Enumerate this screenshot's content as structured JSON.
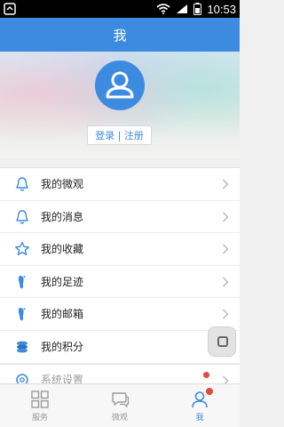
{
  "status_bar": {
    "time": "10:53"
  },
  "header": {
    "title": "我"
  },
  "profile": {
    "login_label": "登录 | 注册"
  },
  "menu": {
    "items": [
      {
        "label": "我的微观",
        "icon": "bell-icon"
      },
      {
        "label": "我的消息",
        "icon": "bell-icon"
      },
      {
        "label": "我的收藏",
        "icon": "star-icon"
      },
      {
        "label": "我的足迹",
        "icon": "footprint-icon"
      },
      {
        "label": "我的邮箱",
        "icon": "footprint-icon"
      },
      {
        "label": "我的积分",
        "icon": "coins-icon"
      }
    ],
    "settings_label": "系统设置"
  },
  "tabs": [
    {
      "label": "服务",
      "icon": "grid-icon"
    },
    {
      "label": "微观",
      "icon": "chat-bubble-icon"
    },
    {
      "label": "我",
      "icon": "person-icon",
      "active": true
    }
  ],
  "colors": {
    "accent": "#3d8be0",
    "badge": "#e24a3a"
  }
}
